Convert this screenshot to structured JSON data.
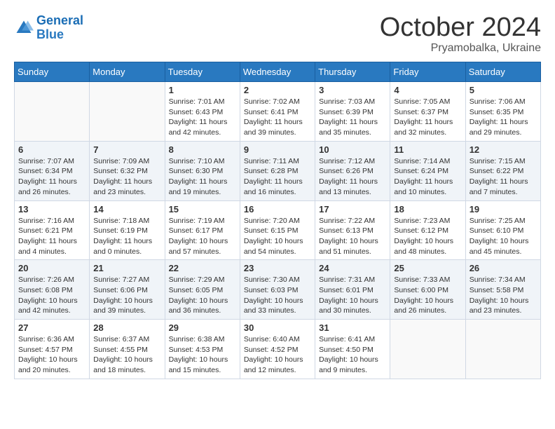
{
  "logo": {
    "line1": "General",
    "line2": "Blue"
  },
  "title": "October 2024",
  "location": "Pryamobalka, Ukraine",
  "days_of_week": [
    "Sunday",
    "Monday",
    "Tuesday",
    "Wednesday",
    "Thursday",
    "Friday",
    "Saturday"
  ],
  "weeks": [
    [
      {
        "day": null
      },
      {
        "day": null
      },
      {
        "day": 1,
        "sunrise": "Sunrise: 7:01 AM",
        "sunset": "Sunset: 6:43 PM",
        "daylight": "Daylight: 11 hours and 42 minutes."
      },
      {
        "day": 2,
        "sunrise": "Sunrise: 7:02 AM",
        "sunset": "Sunset: 6:41 PM",
        "daylight": "Daylight: 11 hours and 39 minutes."
      },
      {
        "day": 3,
        "sunrise": "Sunrise: 7:03 AM",
        "sunset": "Sunset: 6:39 PM",
        "daylight": "Daylight: 11 hours and 35 minutes."
      },
      {
        "day": 4,
        "sunrise": "Sunrise: 7:05 AM",
        "sunset": "Sunset: 6:37 PM",
        "daylight": "Daylight: 11 hours and 32 minutes."
      },
      {
        "day": 5,
        "sunrise": "Sunrise: 7:06 AM",
        "sunset": "Sunset: 6:35 PM",
        "daylight": "Daylight: 11 hours and 29 minutes."
      }
    ],
    [
      {
        "day": 6,
        "sunrise": "Sunrise: 7:07 AM",
        "sunset": "Sunset: 6:34 PM",
        "daylight": "Daylight: 11 hours and 26 minutes."
      },
      {
        "day": 7,
        "sunrise": "Sunrise: 7:09 AM",
        "sunset": "Sunset: 6:32 PM",
        "daylight": "Daylight: 11 hours and 23 minutes."
      },
      {
        "day": 8,
        "sunrise": "Sunrise: 7:10 AM",
        "sunset": "Sunset: 6:30 PM",
        "daylight": "Daylight: 11 hours and 19 minutes."
      },
      {
        "day": 9,
        "sunrise": "Sunrise: 7:11 AM",
        "sunset": "Sunset: 6:28 PM",
        "daylight": "Daylight: 11 hours and 16 minutes."
      },
      {
        "day": 10,
        "sunrise": "Sunrise: 7:12 AM",
        "sunset": "Sunset: 6:26 PM",
        "daylight": "Daylight: 11 hours and 13 minutes."
      },
      {
        "day": 11,
        "sunrise": "Sunrise: 7:14 AM",
        "sunset": "Sunset: 6:24 PM",
        "daylight": "Daylight: 11 hours and 10 minutes."
      },
      {
        "day": 12,
        "sunrise": "Sunrise: 7:15 AM",
        "sunset": "Sunset: 6:22 PM",
        "daylight": "Daylight: 11 hours and 7 minutes."
      }
    ],
    [
      {
        "day": 13,
        "sunrise": "Sunrise: 7:16 AM",
        "sunset": "Sunset: 6:21 PM",
        "daylight": "Daylight: 11 hours and 4 minutes."
      },
      {
        "day": 14,
        "sunrise": "Sunrise: 7:18 AM",
        "sunset": "Sunset: 6:19 PM",
        "daylight": "Daylight: 11 hours and 0 minutes."
      },
      {
        "day": 15,
        "sunrise": "Sunrise: 7:19 AM",
        "sunset": "Sunset: 6:17 PM",
        "daylight": "Daylight: 10 hours and 57 minutes."
      },
      {
        "day": 16,
        "sunrise": "Sunrise: 7:20 AM",
        "sunset": "Sunset: 6:15 PM",
        "daylight": "Daylight: 10 hours and 54 minutes."
      },
      {
        "day": 17,
        "sunrise": "Sunrise: 7:22 AM",
        "sunset": "Sunset: 6:13 PM",
        "daylight": "Daylight: 10 hours and 51 minutes."
      },
      {
        "day": 18,
        "sunrise": "Sunrise: 7:23 AM",
        "sunset": "Sunset: 6:12 PM",
        "daylight": "Daylight: 10 hours and 48 minutes."
      },
      {
        "day": 19,
        "sunrise": "Sunrise: 7:25 AM",
        "sunset": "Sunset: 6:10 PM",
        "daylight": "Daylight: 10 hours and 45 minutes."
      }
    ],
    [
      {
        "day": 20,
        "sunrise": "Sunrise: 7:26 AM",
        "sunset": "Sunset: 6:08 PM",
        "daylight": "Daylight: 10 hours and 42 minutes."
      },
      {
        "day": 21,
        "sunrise": "Sunrise: 7:27 AM",
        "sunset": "Sunset: 6:06 PM",
        "daylight": "Daylight: 10 hours and 39 minutes."
      },
      {
        "day": 22,
        "sunrise": "Sunrise: 7:29 AM",
        "sunset": "Sunset: 6:05 PM",
        "daylight": "Daylight: 10 hours and 36 minutes."
      },
      {
        "day": 23,
        "sunrise": "Sunrise: 7:30 AM",
        "sunset": "Sunset: 6:03 PM",
        "daylight": "Daylight: 10 hours and 33 minutes."
      },
      {
        "day": 24,
        "sunrise": "Sunrise: 7:31 AM",
        "sunset": "Sunset: 6:01 PM",
        "daylight": "Daylight: 10 hours and 30 minutes."
      },
      {
        "day": 25,
        "sunrise": "Sunrise: 7:33 AM",
        "sunset": "Sunset: 6:00 PM",
        "daylight": "Daylight: 10 hours and 26 minutes."
      },
      {
        "day": 26,
        "sunrise": "Sunrise: 7:34 AM",
        "sunset": "Sunset: 5:58 PM",
        "daylight": "Daylight: 10 hours and 23 minutes."
      }
    ],
    [
      {
        "day": 27,
        "sunrise": "Sunrise: 6:36 AM",
        "sunset": "Sunset: 4:57 PM",
        "daylight": "Daylight: 10 hours and 20 minutes."
      },
      {
        "day": 28,
        "sunrise": "Sunrise: 6:37 AM",
        "sunset": "Sunset: 4:55 PM",
        "daylight": "Daylight: 10 hours and 18 minutes."
      },
      {
        "day": 29,
        "sunrise": "Sunrise: 6:38 AM",
        "sunset": "Sunset: 4:53 PM",
        "daylight": "Daylight: 10 hours and 15 minutes."
      },
      {
        "day": 30,
        "sunrise": "Sunrise: 6:40 AM",
        "sunset": "Sunset: 4:52 PM",
        "daylight": "Daylight: 10 hours and 12 minutes."
      },
      {
        "day": 31,
        "sunrise": "Sunrise: 6:41 AM",
        "sunset": "Sunset: 4:50 PM",
        "daylight": "Daylight: 10 hours and 9 minutes."
      },
      {
        "day": null
      },
      {
        "day": null
      }
    ]
  ]
}
